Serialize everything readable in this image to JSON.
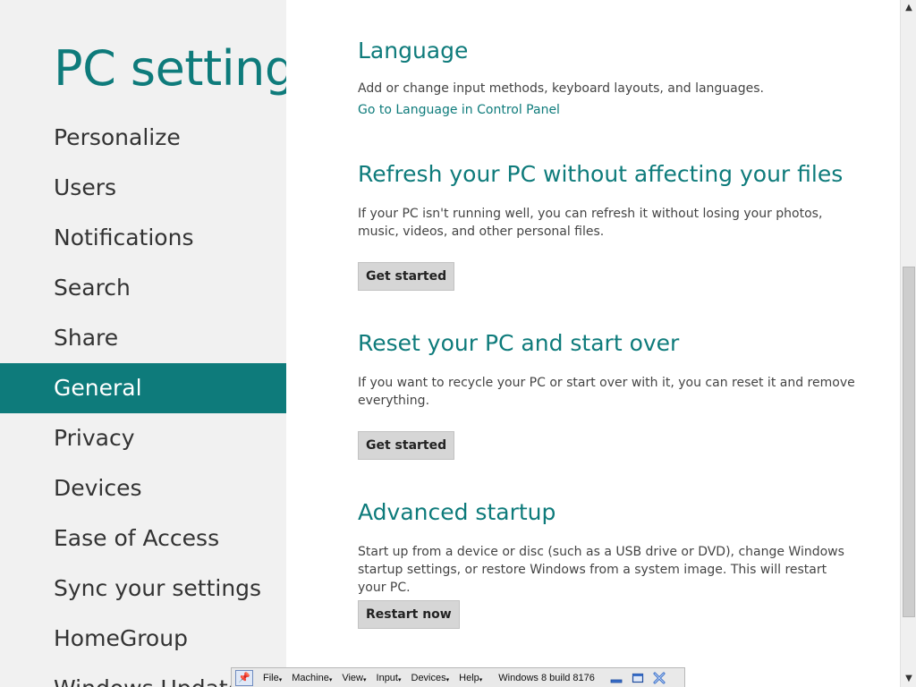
{
  "app": {
    "title": "PC settings"
  },
  "nav": {
    "items": [
      {
        "label": "Personalize"
      },
      {
        "label": "Users"
      },
      {
        "label": "Notifications"
      },
      {
        "label": "Search"
      },
      {
        "label": "Share"
      },
      {
        "label": "General",
        "selected": true
      },
      {
        "label": "Privacy"
      },
      {
        "label": "Devices"
      },
      {
        "label": "Ease of Access"
      },
      {
        "label": "Sync your settings"
      },
      {
        "label": "HomeGroup"
      },
      {
        "label": "Windows Update"
      }
    ]
  },
  "sections": {
    "language": {
      "heading": "Language",
      "description": "Add or change input methods, keyboard layouts, and languages.",
      "link": "Go to Language in Control Panel"
    },
    "refresh": {
      "heading": "Refresh your PC without affecting your files",
      "description": "If your PC isn't running well, you can refresh it without losing your photos, music, videos, and other personal files.",
      "button": "Get started"
    },
    "reset": {
      "heading": "Reset your PC and start over",
      "description": "If you want to recycle your PC or start over with it, you can reset it and remove everything.",
      "button": "Get started"
    },
    "advanced": {
      "heading": "Advanced startup",
      "description": "Start up from a device or disc (such as a USB drive or DVD), change Windows startup settings, or restore Windows from a system image. This will restart your PC.",
      "button": "Restart now"
    }
  },
  "vbox_toolbar": {
    "menus": [
      "File",
      "Machine",
      "View",
      "Input",
      "Devices",
      "Help"
    ],
    "title": "Windows 8 build 8176"
  },
  "theme": {
    "accent": "#0e7b7b",
    "pane_bg": "#f1f1f1"
  }
}
